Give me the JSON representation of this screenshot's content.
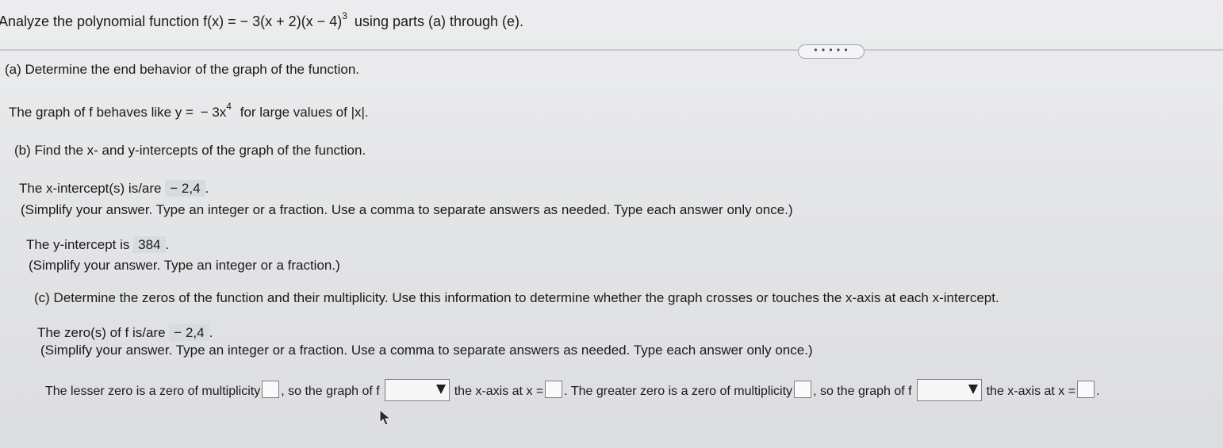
{
  "question": {
    "prefix": "Analyze the polynomial function f(x) = − 3(x + 2)(x − 4)",
    "exponent": "3",
    "suffix": "using parts (a) through (e)."
  },
  "ellipsis_label": "• • • • •",
  "part_a": {
    "title": "(a) Determine the end behavior of the graph of the function.",
    "line_prefix": "The graph of f behaves like y =",
    "answer_base": "− 3x",
    "answer_exp": "4",
    "line_suffix": "for large values of |x|."
  },
  "part_b": {
    "title": "(b) Find the x- and y-intercepts of the graph of the function.",
    "x_intercept_label": "The x-intercept(s) is/are",
    "x_intercept_value": "− 2,4",
    "x_hint": "(Simplify your answer. Type an integer or a fraction. Use a comma to separate answers as needed. Type each answer only once.)",
    "y_intercept_label": "The y-intercept is",
    "y_intercept_value": "384",
    "y_hint": "(Simplify your answer. Type an integer or a fraction.)"
  },
  "part_c": {
    "title": "(c) Determine the zeros of the function and their multiplicity. Use this information to determine whether the graph crosses or touches the x-axis at each x-intercept.",
    "zeros_label": "The zero(s) of f is/are",
    "zeros_value": "− 2,4",
    "zeros_hint": "(Simplify your answer. Type an integer or a fraction. Use a comma to separate answers as needed. Type each answer only once.)",
    "lesser_text": "The lesser zero is a zero of multiplicity",
    "so_graph": ", so the graph of f",
    "axis_at": "the x-axis at x =",
    "greater_text": ". The greater zero is a zero of multiplicity",
    "so_graph_2": ", so the graph of f",
    "axis_at_2": "the x-axis at x =",
    "end_period": "."
  }
}
